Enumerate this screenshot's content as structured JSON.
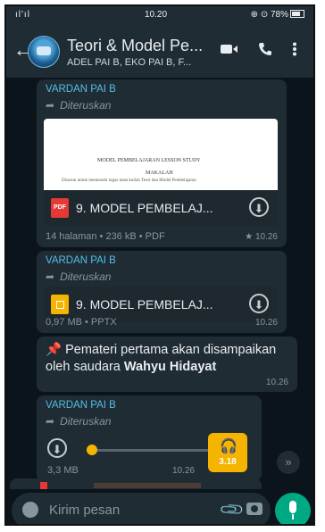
{
  "status_bar": {
    "signal": "ᴵᴵᴵ ᴵᴵᴵ",
    "time": "10.20",
    "battery": "78%"
  },
  "header": {
    "back_icon": "back-arrow-icon",
    "title": "Teori & Model Pe...",
    "subtitle": "ADEL PAI B, EKO PAI B, F...",
    "icons": [
      "video-call-icon",
      "phone-icon",
      "more-vert-icon"
    ]
  },
  "messages": [
    {
      "sender": "VARDAN PAI B",
      "forwarded": "Diteruskan",
      "preview_line1": "MODEL PEMBELAJARAN LESSON STUDY",
      "preview_line2": "MAKALAH",
      "preview_line3": "Disusun untuk memenuhi tugas mata kuliah Teori dan Model Pembelajaran",
      "file_name": "9. MODEL PEMBELAJ...",
      "file_type": "PDF",
      "meta": "14 halaman • 236 kB • PDF",
      "time": "★ 10.26"
    },
    {
      "sender": "VARDAN PAI B",
      "forwarded": "Diteruskan",
      "file_name": "9. MODEL PEMBELAJ...",
      "file_type": "PPTX",
      "meta": "0,97 MB • PPTX",
      "time": "10.26"
    },
    {
      "emoji": "📌",
      "text_plain": "Pemateri pertama akan disampaikan oleh saudara",
      "text_bold": "Wahyu Hidayat",
      "time": "10.26"
    },
    {
      "sender": "VARDAN PAI B",
      "forwarded": "Diteruskan",
      "size": "3,3 MB",
      "time": "10.26",
      "duration": "3.18"
    }
  ],
  "input": {
    "placeholder": "Kirim pesan"
  },
  "colors": {
    "header_bg": "#1f2c34",
    "chat_bg": "#0b141a",
    "bubble_bg": "#202c33",
    "accent_green": "#00a884",
    "sender_blue": "#53bdeb"
  }
}
